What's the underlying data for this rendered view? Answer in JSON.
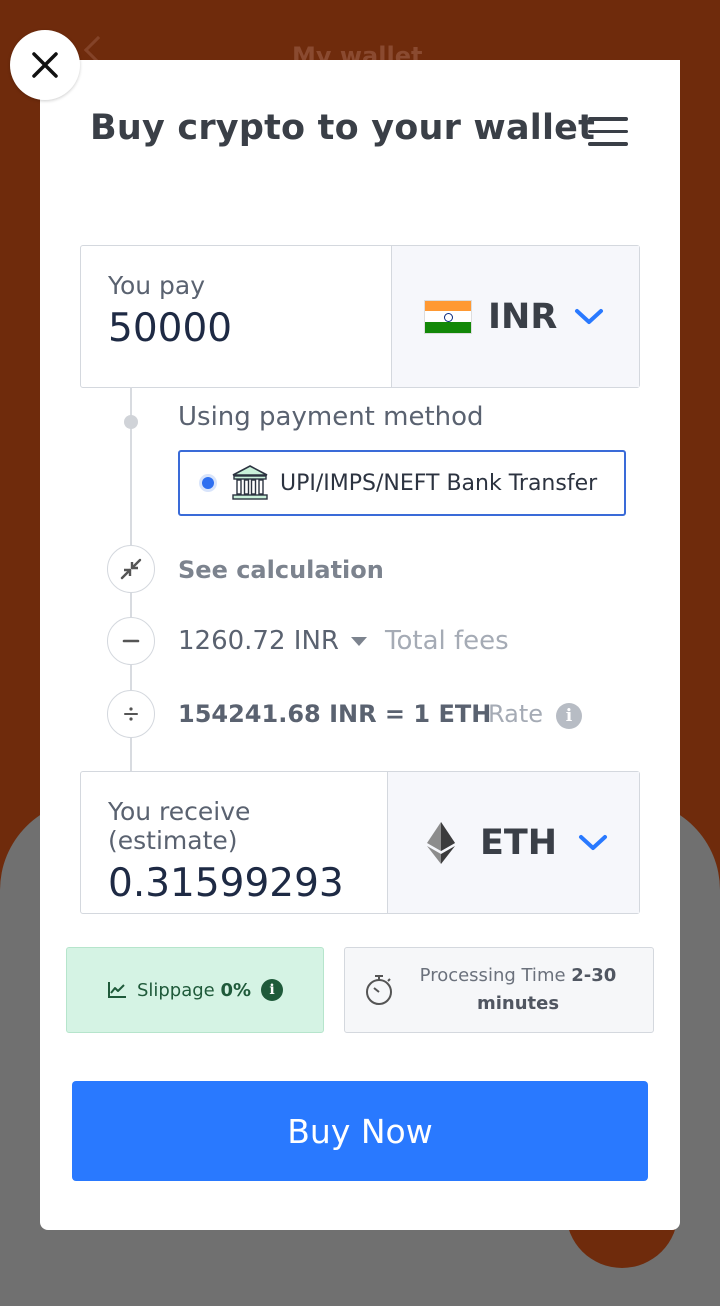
{
  "background": {
    "header_title": "My wallet"
  },
  "modal": {
    "title": "Buy crypto to your wallet"
  },
  "pay": {
    "label": "You pay",
    "amount": "50000",
    "currency": "INR"
  },
  "payment_method": {
    "label": "Using payment method",
    "option": "UPI/IMPS/NEFT Bank Transfer"
  },
  "calculation": {
    "see_label": "See calculation",
    "fees_value": "1260.72 INR",
    "fees_label": "Total fees",
    "rate_value": "154241.68 INR = 1 ETH",
    "rate_label": "Rate"
  },
  "receive": {
    "label": "You receive (estimate)",
    "amount": "0.31599293",
    "currency": "ETH"
  },
  "slippage": {
    "label": "Slippage",
    "value": "0%"
  },
  "processing": {
    "label": "Processing Time",
    "value_line1": "2-30",
    "value_line2": "minutes"
  },
  "buy_button": {
    "label": "Buy Now"
  },
  "colors": {
    "primary": "#2979ff",
    "slippage_bg": "#d5f3e4",
    "backdrop": "#6f2b0c"
  },
  "icons": {
    "close": "close-icon",
    "menu": "menu-icon",
    "flag": "india-flag-icon",
    "chevron": "chevron-down-icon",
    "bank": "bank-icon",
    "compress": "compress-icon",
    "minus": "minus-icon",
    "divide": "divide-icon",
    "info": "info-icon",
    "eth": "ethereum-icon",
    "chart": "chart-line-icon",
    "timer": "stopwatch-icon"
  }
}
